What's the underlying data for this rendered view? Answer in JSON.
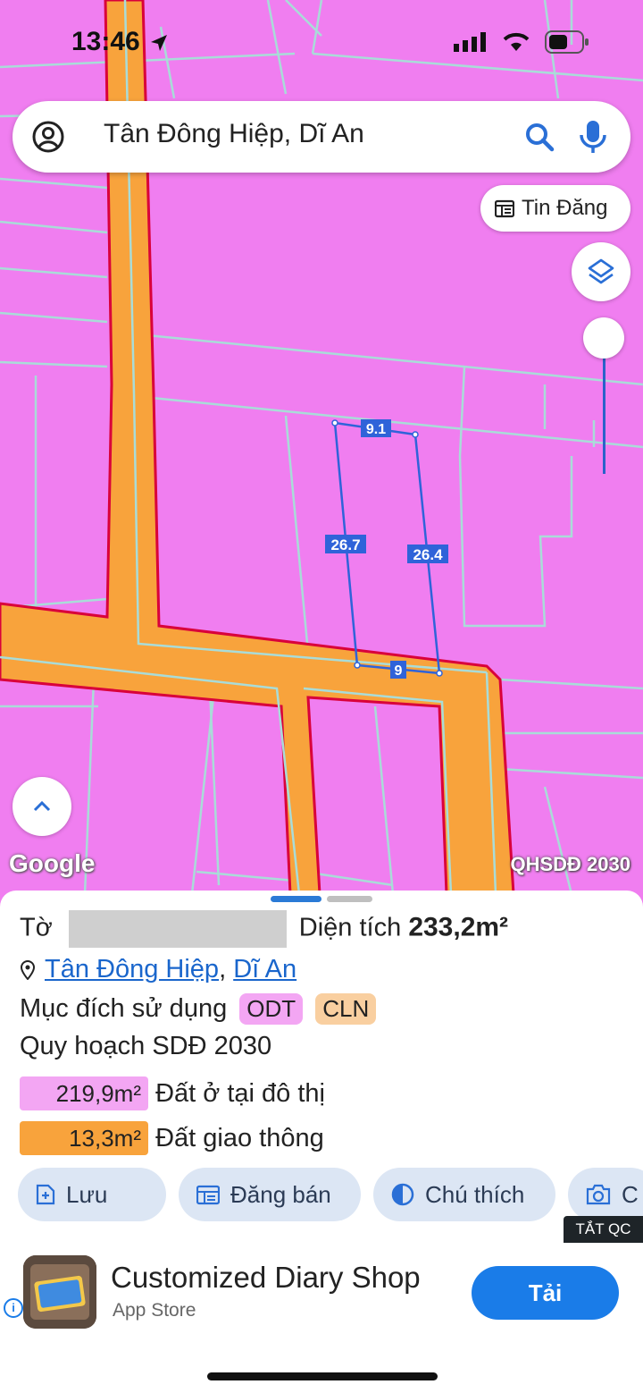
{
  "status": {
    "time": "13:46"
  },
  "search": {
    "text": "Tân Đông Hiệp, Dĩ An"
  },
  "map": {
    "tin_dang": "Tin Đăng",
    "google": "Google",
    "layer_name": "QHSDĐ 2030",
    "parcel_labels": {
      "top": "9.1",
      "left": "26.7",
      "right": "26.4",
      "bottom": "9"
    }
  },
  "sheet": {
    "to_label": "Tờ",
    "area_label": "Diện tích",
    "area_value": "233,2m²",
    "location_ward": "Tân Đông Hiệp",
    "location_sep": ",",
    "location_city": "Dĩ An",
    "purpose_label": "Mục đích sử dụng",
    "badges": [
      {
        "text": "ODT",
        "color": "#f3a6f3"
      },
      {
        "text": "CLN",
        "color": "#f9cfa0"
      }
    ],
    "plan_label": "Quy hoạch SDĐ 2030",
    "legend": [
      {
        "value": "219,9m²",
        "label": "Đất ở tại đô thị",
        "color": "#f3a6f3"
      },
      {
        "value": "13,3m²",
        "label": "Đất giao thông",
        "color": "#f8a33c"
      }
    ],
    "buttons": {
      "save": "Lưu",
      "sell": "Đăng bán",
      "legend": "Chú thích",
      "capture": "C"
    }
  },
  "ad": {
    "close": "TẮT QC",
    "title": "Customized Diary Shop",
    "store": "App Store",
    "cta": "Tải",
    "logo_text": "Customized Diary Shop",
    "info": "i"
  }
}
